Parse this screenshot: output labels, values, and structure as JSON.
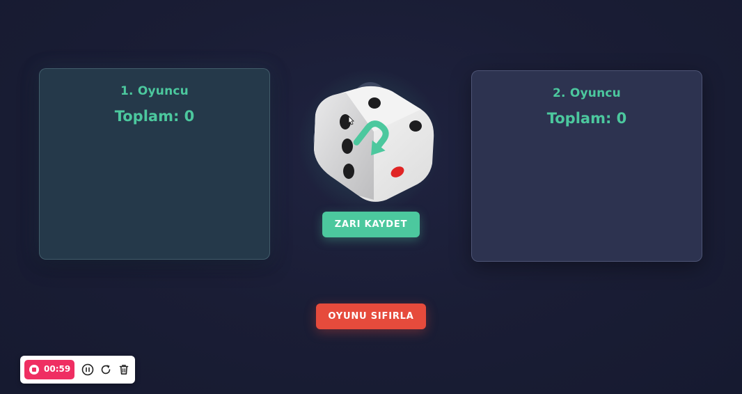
{
  "players": [
    {
      "name": "1. Oyuncu",
      "total": "Toplam: 0"
    },
    {
      "name": "2. Oyuncu",
      "total": "Toplam: 0"
    }
  ],
  "actions": {
    "save_dice_label": "ZARI KAYDET",
    "reset_game_label": "OYUNU SIFIRLA"
  },
  "dice": {
    "logo_icon": "undo-arrow-icon",
    "pips_dark_color": "#1d1d1f",
    "pip_red_color": "#e02424",
    "accent_color": "#4cc89e"
  },
  "recorder": {
    "elapsed": "00:59",
    "icons": [
      "stop-icon",
      "pause-icon",
      "restart-icon",
      "trash-icon"
    ],
    "accent_color": "#ef2e62"
  },
  "colors": {
    "accent": "#4cc89e",
    "danger": "#e64b3c",
    "background": "#1a1d35"
  }
}
